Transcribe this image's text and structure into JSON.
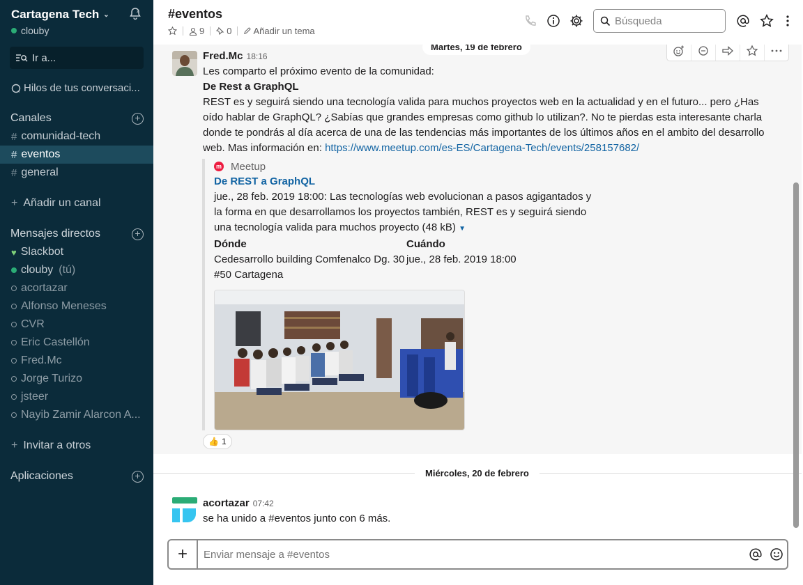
{
  "sidebar": {
    "team_name": "Cartagena Tech",
    "current_user": "clouby",
    "jump_label": "Ir a...",
    "threads_label": "Hilos de tus conversaci...",
    "channels_title": "Canales",
    "channels": [
      {
        "label": "comunidad-tech",
        "active": false
      },
      {
        "label": "eventos",
        "active": true
      },
      {
        "label": "general",
        "active": false
      }
    ],
    "add_channel": "Añadir un canal",
    "dm_title": "Mensajes directos",
    "dms": [
      {
        "label": "Slackbot"
      },
      {
        "label": "clouby",
        "suffix": "(tú)"
      },
      {
        "label": "acortazar"
      },
      {
        "label": "Alfonso Meneses"
      },
      {
        "label": "CVR"
      },
      {
        "label": "Eric Castellón"
      },
      {
        "label": "Fred.Mc"
      },
      {
        "label": "Jorge Turizo"
      },
      {
        "label": "jsteer"
      },
      {
        "label": "Nayib Zamir Alarcon A..."
      }
    ],
    "invite": "Invitar a otros",
    "apps_title": "Aplicaciones"
  },
  "header": {
    "channel": "#eventos",
    "members": "9",
    "pins": "0",
    "add_topic": "Añadir un tema",
    "search_placeholder": "Búsqueda"
  },
  "messages": {
    "date1": "Martes, 19 de febrero",
    "msg1": {
      "author": "Fred.Mc",
      "time": "18:16",
      "line1": "Les comparto el próximo evento de la comunidad:",
      "heading": "De Rest a GraphQL",
      "paragraph": "REST es y seguirá siendo una tecnología valida para muchos proyectos web en la actualidad y en el futuro... pero ¿Has oído hablar de GraphQL? ¿Sabías que grandes empresas como github lo utilizan?. No te pierdas esta interesante charla donde te pondrás al día acerca de una de las tendencias más importantes de los últimos años en el ambito del desarrollo web. Mas información en:",
      "url": "https://www.meetup.com/es-ES/Cartagena-Tech/events/258157682/"
    },
    "attachment": {
      "service": "Meetup",
      "title": "De REST a GraphQL",
      "text": "jue., 28 feb. 2019 18:00: Las tecnologías web evolucionan a pasos agigantados y la forma en que desarrollamos los proyectos también, REST es y seguirá siendo una tecnología valida para muchos proyecto",
      "size": "(48 kB)",
      "where_label": "Dónde",
      "where_value": "Cedesarrollo building Comfenalco Dg. 30 #50 Cartagena",
      "when_label": "Cuándo",
      "when_value": "jue., 28 feb. 2019 18:00"
    },
    "reaction_count": "1",
    "date2": "Miércoles, 20 de febrero",
    "msg2": {
      "author": "acortazar",
      "time": "07:42",
      "text": "se ha unido a #eventos junto con 6 más."
    }
  },
  "composer": {
    "placeholder": "Enviar mensaje a #eventos"
  },
  "colors": {
    "sidebar_bg": "#0b2b3a",
    "active_channel": "#1d4b5d",
    "link": "#1264a3",
    "presence": "#2bac76"
  }
}
